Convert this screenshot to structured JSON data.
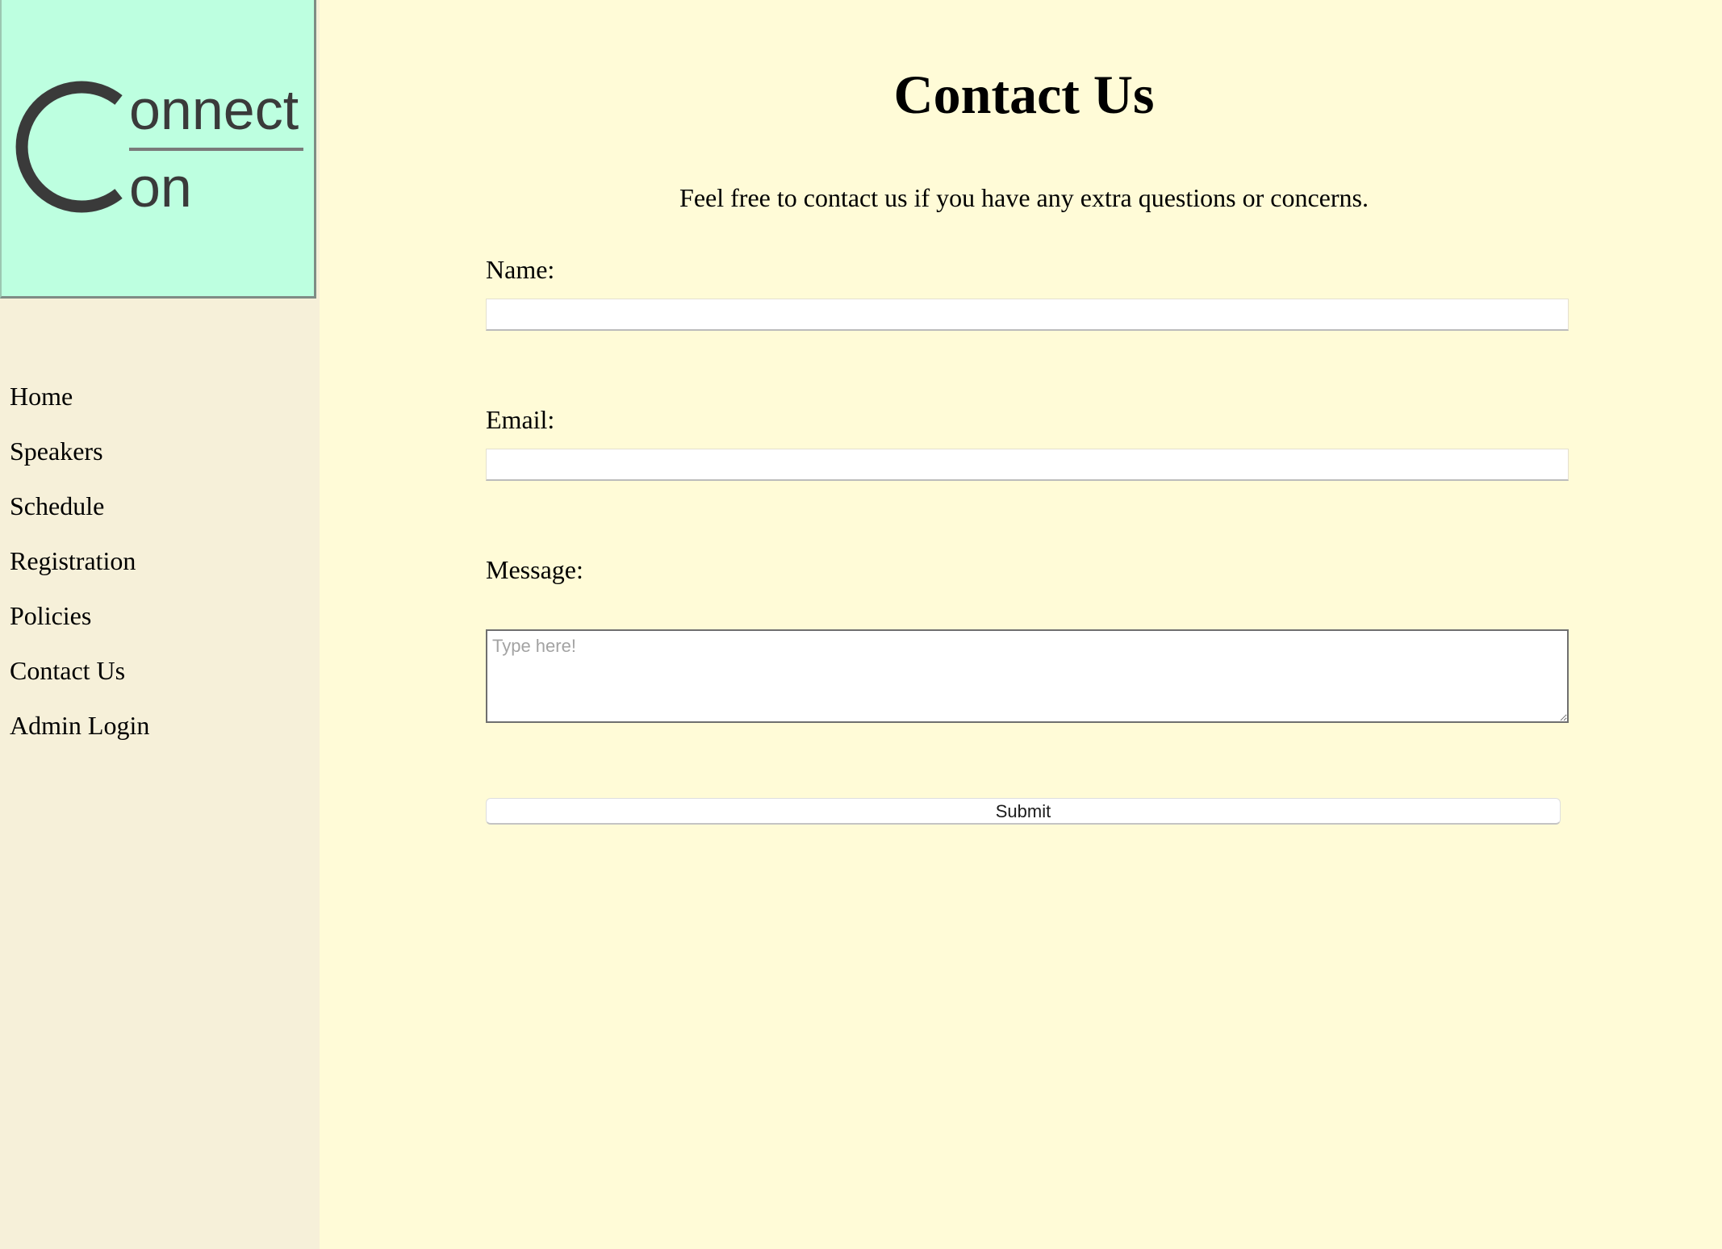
{
  "sidebar": {
    "logo": {
      "text_line1": "onnect",
      "text_line2": "on",
      "initial": "C",
      "background": "#bdffe0",
      "ink": "#3a3a3a"
    },
    "nav_items": [
      {
        "label": "Home"
      },
      {
        "label": "Speakers"
      },
      {
        "label": "Schedule"
      },
      {
        "label": "Registration"
      },
      {
        "label": "Policies"
      },
      {
        "label": "Contact Us"
      },
      {
        "label": "Admin Login"
      }
    ]
  },
  "main": {
    "title": "Contact Us",
    "intro": "Feel free to contact us if you have any extra questions or concerns.",
    "form": {
      "name_label": "Name:",
      "name_value": "",
      "email_label": "Email:",
      "email_value": "",
      "message_label": "Message:",
      "message_placeholder": "Type here!",
      "submit_label": "Submit"
    }
  },
  "colors": {
    "page_background": "#fffbd7",
    "sidebar_background": "#f6f0d9",
    "logo_background": "#bdffe0"
  }
}
